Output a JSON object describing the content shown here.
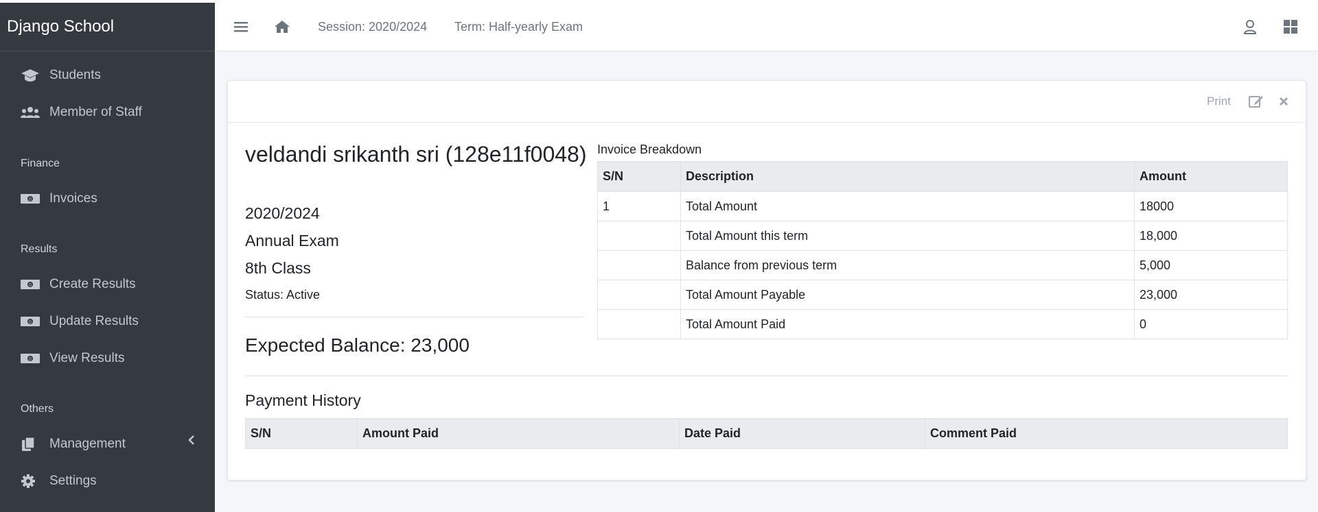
{
  "brand": "Django School",
  "sidebar": {
    "items": [
      {
        "label": "Students",
        "icon": "graduation-cap-icon"
      },
      {
        "label": "Member of Staff",
        "icon": "users-icon"
      }
    ],
    "sections": [
      {
        "header": "Finance",
        "items": [
          {
            "label": "Invoices",
            "icon": "money-bill-icon"
          }
        ]
      },
      {
        "header": "Results",
        "items": [
          {
            "label": "Create Results",
            "icon": "money-bill-icon"
          },
          {
            "label": "Update Results",
            "icon": "money-bill-icon"
          },
          {
            "label": "View Results",
            "icon": "money-bill-icon"
          }
        ]
      },
      {
        "header": "Others",
        "items": [
          {
            "label": "Management",
            "icon": "copy-icon"
          },
          {
            "label": "Settings",
            "icon": "gear-icon"
          }
        ]
      }
    ]
  },
  "topbar": {
    "session": "Session: 2020/2024",
    "term": "Term: Half-yearly Exam"
  },
  "card": {
    "print_label": "Print",
    "student_name": "veldandi srikanth sri (128e11f0048)",
    "session": "2020/2024",
    "exam": "Annual Exam",
    "class_name": "8th Class",
    "status": "Status: Active",
    "expected_balance": "Expected Balance: 23,000",
    "invoice_caption": "Invoice Breakdown",
    "invoice_headers": [
      "S/N",
      "Description",
      "Amount"
    ],
    "invoice_rows": [
      [
        "1",
        "Total Amount",
        "18000"
      ],
      [
        "",
        "Total Amount this term",
        "18,000"
      ],
      [
        "",
        "Balance from previous term",
        "5,000"
      ],
      [
        "",
        "Total Amount Payable",
        "23,000"
      ],
      [
        "",
        "Total Amount Paid",
        "0"
      ]
    ],
    "payment_history_title": "Payment History",
    "payment_headers": [
      "S/N",
      "Amount Paid",
      "Date Paid",
      "Comment Paid"
    ]
  },
  "colors": {
    "sidebar_bg": "#343a40",
    "page_bg": "#f4f6f9",
    "table_head_bg": "#e9ecef"
  }
}
